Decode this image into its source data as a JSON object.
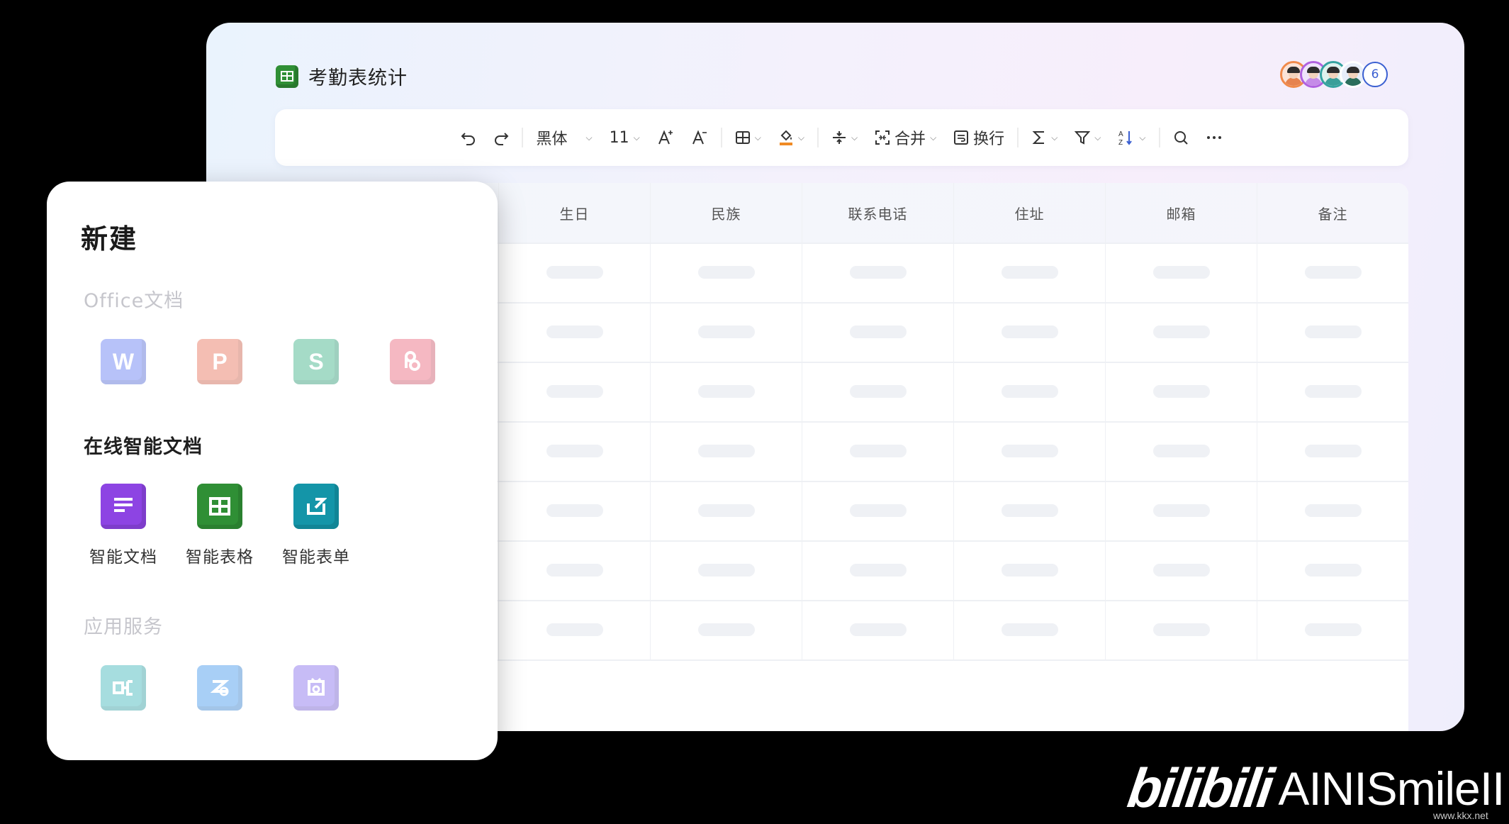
{
  "document": {
    "title": "考勤表统计",
    "collaborator_count": "6"
  },
  "toolbar": {
    "font_family": "黑体",
    "font_size": "11",
    "merge_label": "合并",
    "wrap_label": "换行"
  },
  "table": {
    "columns": [
      "生日",
      "民族",
      "联系电话",
      "住址",
      "邮箱",
      "备注"
    ],
    "row_count": 7
  },
  "new_panel": {
    "title": "新建",
    "office_section": "Office文档",
    "office_apps": [
      {
        "letter": "W",
        "color": "#7d92f5"
      },
      {
        "letter": "P",
        "color": "#ec8a76"
      },
      {
        "letter": "S",
        "color": "#5cbf9b"
      },
      {
        "letter": "",
        "color": "#ee7f92"
      }
    ],
    "smart_section": "在线智能文档",
    "smart_apps": [
      {
        "label": "智能文档",
        "color": "#8d44e3"
      },
      {
        "label": "智能表格",
        "color": "#2f8f35"
      },
      {
        "label": "智能表单",
        "color": "#1495a8"
      }
    ],
    "services_section": "应用服务",
    "service_apps": [
      {
        "color": "#5fc3c6"
      },
      {
        "color": "#62a9f0"
      },
      {
        "color": "#9a86f0"
      }
    ]
  },
  "watermark": {
    "logo": "bilibili",
    "user": "AINISmileII",
    "site": "www.kkx.net"
  }
}
